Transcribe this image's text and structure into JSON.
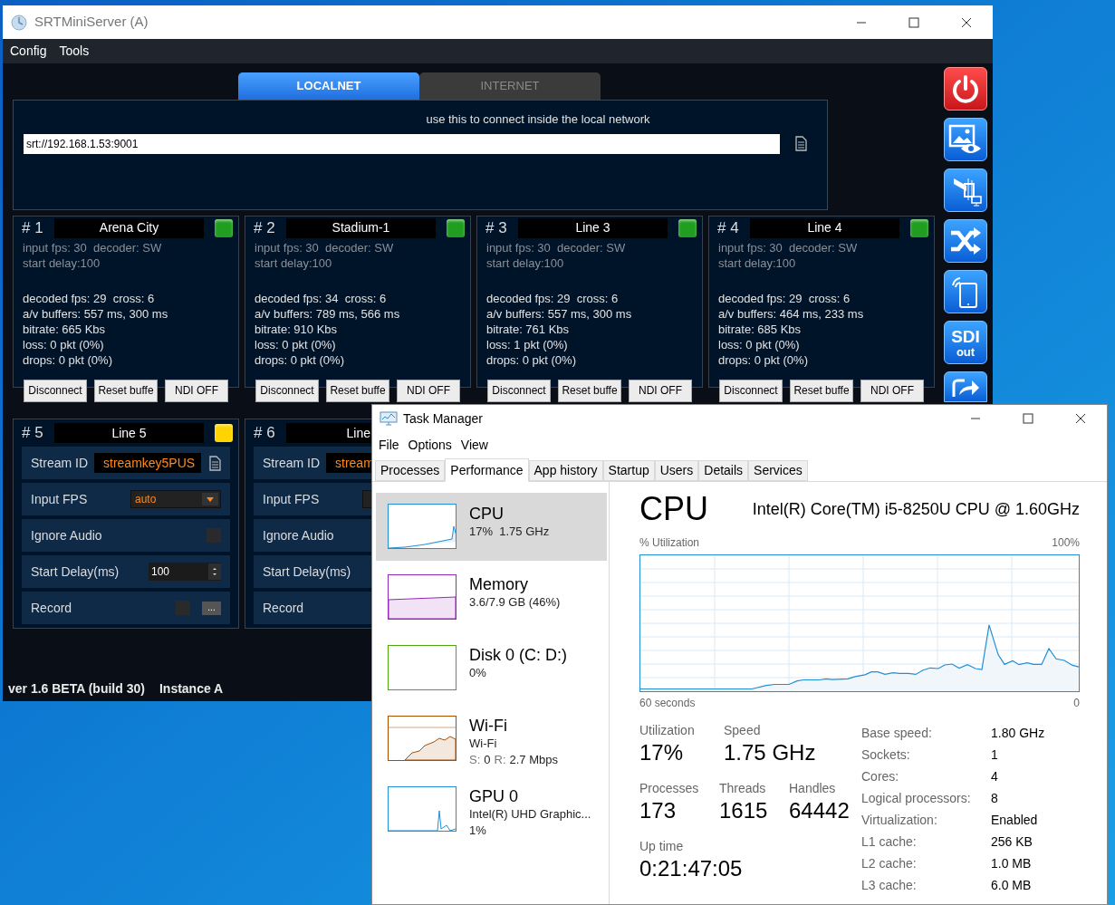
{
  "srt_window": {
    "title": "SRTMiniServer (A)",
    "menu": [
      "Config",
      "Tools"
    ],
    "tabs": [
      {
        "label": "LOCALNET",
        "selected": true
      },
      {
        "label": "INTERNET",
        "selected": false
      }
    ],
    "connect_hint": "use this to connect inside the local network",
    "url": "srt://192.168.1.53:9001",
    "channels": [
      {
        "number": "# 1",
        "name": "Arena City",
        "color": "#1f9e1f",
        "info": [
          "input fps: 30  decoder: SW",
          "start delay:100"
        ],
        "stats": [
          "decoded fps: 29  cross: 6",
          "a/v buffers: 557 ms, 300 ms",
          "bitrate: 665 Kbs",
          "loss: 0 pkt (0%)",
          "drops: 0 pkt (0%)"
        ],
        "buttons": [
          "Disconnect",
          "Reset buffe",
          "NDI OFF"
        ]
      },
      {
        "number": "# 2",
        "name": "Stadium-1",
        "color": "#1f9e1f",
        "info": [
          "input fps: 30  decoder: SW",
          "start delay:100"
        ],
        "stats": [
          "decoded fps: 34  cross: 6",
          "a/v buffers: 789 ms, 566 ms",
          "bitrate: 910 Kbs",
          "loss: 0 pkt (0%)",
          "drops: 0 pkt (0%)"
        ],
        "buttons": [
          "Disconnect",
          "Reset buffe",
          "NDI OFF"
        ]
      },
      {
        "number": "# 3",
        "name": "Line 3",
        "color": "#1f9e1f",
        "info": [
          "input fps: 30  decoder: SW",
          "start delay:100"
        ],
        "stats": [
          "decoded fps: 29  cross: 6",
          "a/v buffers: 557 ms, 300 ms",
          "bitrate: 761 Kbs",
          "loss: 1 pkt (0%)",
          "drops: 0 pkt (0%)"
        ],
        "buttons": [
          "Disconnect",
          "Reset buffe",
          "NDI OFF"
        ]
      },
      {
        "number": "# 4",
        "name": "Line 4",
        "color": "#1f9e1f",
        "info": [
          "input fps: 30  decoder: SW",
          "start delay:100"
        ],
        "stats": [
          "decoded fps: 29  cross: 6",
          "a/v buffers: 464 ms, 233 ms",
          "bitrate: 685 Kbs",
          "loss: 0 pkt (0%)",
          "drops: 0 pkt (0%)"
        ],
        "buttons": [
          "Disconnect",
          "Reset buffe",
          "NDI OFF"
        ]
      }
    ],
    "config_channels": [
      {
        "number": "# 5",
        "name": "Line 5",
        "color": "#ffd400",
        "rows": [
          {
            "kind": "stream_id",
            "label": "Stream ID",
            "value": "streamkey5PUS"
          },
          {
            "kind": "select",
            "label": "Input FPS",
            "value": "auto"
          },
          {
            "kind": "checkbox",
            "label": "Ignore Audio",
            "checked": false
          },
          {
            "kind": "spin",
            "label": "Start Delay(ms)",
            "value": "100"
          },
          {
            "kind": "record",
            "label": "Record",
            "checked": false,
            "button": "..."
          }
        ]
      },
      {
        "number": "# 6",
        "name": "Line",
        "rows": [
          {
            "kind": "stream_id",
            "label": "Stream ID",
            "value": "stream"
          },
          {
            "kind": "select_stub",
            "label": "Input FPS"
          },
          {
            "kind": "label",
            "label": "Ignore Audio"
          },
          {
            "kind": "label",
            "label": "Start Delay(ms)"
          },
          {
            "kind": "label",
            "label": "Record"
          }
        ]
      }
    ],
    "side_buttons": [
      {
        "kind": "power"
      },
      {
        "kind": "preview"
      },
      {
        "kind": "camera"
      },
      {
        "kind": "shuffle"
      },
      {
        "kind": "remote"
      },
      {
        "kind": "sdi",
        "label": "SDI",
        "sublabel": "out"
      },
      {
        "kind": "share"
      }
    ],
    "status": [
      "ver 1.6 BETA (build 30)",
      "Instance A"
    ]
  },
  "task_manager": {
    "title": "Task Manager",
    "menu": [
      "File",
      "Options",
      "View"
    ],
    "tabs": [
      {
        "label": "Processes",
        "selected": false
      },
      {
        "label": "Performance",
        "selected": true
      },
      {
        "label": "App history",
        "selected": false
      },
      {
        "label": "Startup",
        "selected": false
      },
      {
        "label": "Users",
        "selected": false
      },
      {
        "label": "Details",
        "selected": false
      },
      {
        "label": "Services",
        "selected": false
      }
    ],
    "resources": [
      {
        "kind": "cpu",
        "name": "CPU",
        "color": "#1f8fd6",
        "selected": true,
        "lines": [
          "17%  1.75 GHz"
        ]
      },
      {
        "kind": "memory",
        "name": "Memory",
        "color": "#9528b4",
        "selected": false,
        "lines": [
          "3.6/7.9 GB (46%)"
        ]
      },
      {
        "kind": "disk",
        "name": "Disk 0 (C: D:)",
        "color": "#4da60c",
        "selected": false,
        "lines": [
          "0%"
        ]
      },
      {
        "kind": "network",
        "name": "Wi-Fi",
        "color": "#a74f01",
        "selected": false,
        "lines": [
          "Wi-Fi"
        ],
        "rates": [
          {
            "label": "S:",
            "value": "0"
          },
          {
            "label": "R:",
            "value": "2.7 Mbps"
          }
        ]
      },
      {
        "kind": "gpu",
        "name": "GPU 0",
        "color": "#1f8fd6",
        "selected": false,
        "lines": [
          "Intel(R) UHD Graphic...",
          "1%"
        ]
      }
    ],
    "detail": {
      "title": "CPU",
      "model": "Intel(R) Core(TM) i5-8250U CPU @ 1.60GHz",
      "graph_label": "% Utilization",
      "graph_max": "100%",
      "graph_span": "60 seconds",
      "graph_end": "0",
      "stats": [
        {
          "label": "Utilization",
          "value": "17%"
        },
        {
          "label": "Speed",
          "value": "1.75 GHz"
        }
      ],
      "counts": [
        {
          "label": "Processes",
          "value": "173"
        },
        {
          "label": "Threads",
          "value": "1615"
        },
        {
          "label": "Handles",
          "value": "64442"
        }
      ],
      "uptime": {
        "label": "Up time",
        "value": "0:21:47:05"
      },
      "specs": [
        {
          "label": "Base speed:",
          "value": "1.80 GHz"
        },
        {
          "label": "Sockets:",
          "value": "1"
        },
        {
          "label": "Cores:",
          "value": "4"
        },
        {
          "label": "Logical processors:",
          "value": "8"
        },
        {
          "label": "Virtualization:",
          "value": "Enabled"
        },
        {
          "label": "L1 cache:",
          "value": "256 KB"
        },
        {
          "label": "L2 cache:",
          "value": "1.0 MB"
        },
        {
          "label": "L3 cache:",
          "value": "6.0 MB"
        }
      ]
    }
  }
}
